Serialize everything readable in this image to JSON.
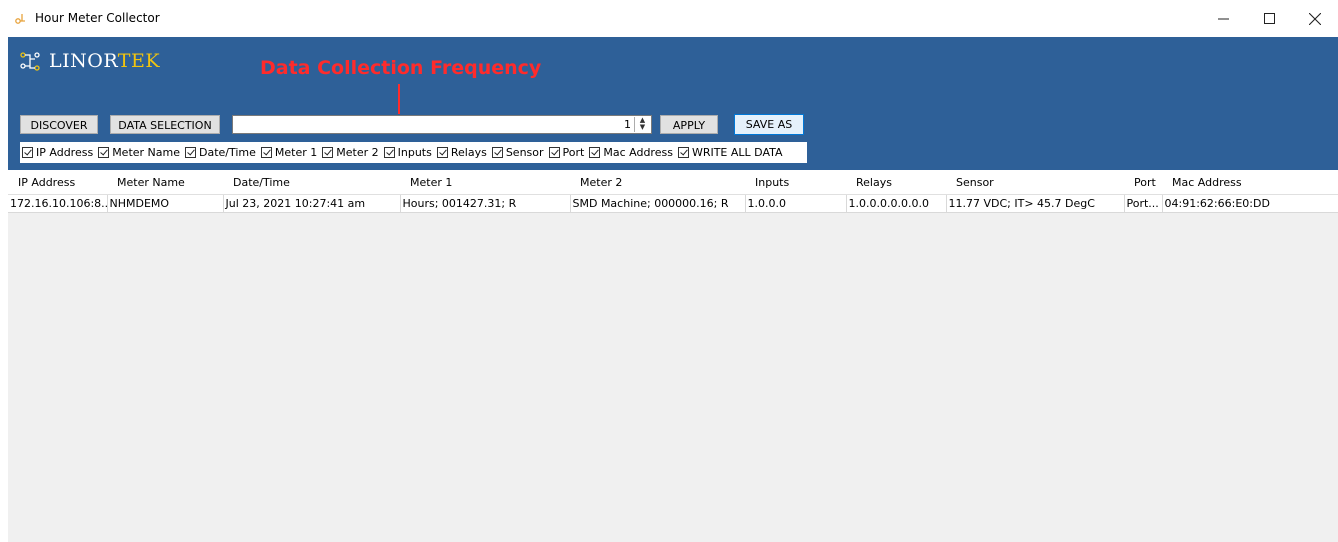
{
  "window": {
    "title": "Hour Meter Collector",
    "controls": {
      "minimize": "—",
      "maximize": "☐",
      "close": "✕"
    }
  },
  "header": {
    "logo": {
      "text_main": "LINOR",
      "text_accent": "TEK",
      "accent_color": "#f1c40f"
    },
    "annotation": {
      "text": "Data Collection Frequency",
      "color": "#ff2b2b"
    },
    "background_color": "#2e6098"
  },
  "toolbar": {
    "discover_label": "DISCOVER",
    "data_selection_label": "DATA SELECTION",
    "frequency_value": "1",
    "apply_label": "APPLY",
    "save_as_label": "SAVE AS"
  },
  "checkboxes": [
    {
      "label": "IP Address",
      "checked": true
    },
    {
      "label": "Meter Name",
      "checked": true
    },
    {
      "label": "Date/Time",
      "checked": true
    },
    {
      "label": "Meter 1",
      "checked": true
    },
    {
      "label": "Meter 2",
      "checked": true
    },
    {
      "label": "Inputs",
      "checked": true
    },
    {
      "label": "Relays",
      "checked": true
    },
    {
      "label": "Sensor",
      "checked": true
    },
    {
      "label": "Port",
      "checked": true
    },
    {
      "label": "Mac Address",
      "checked": true
    },
    {
      "label": "WRITE ALL DATA",
      "checked": true
    }
  ],
  "table": {
    "columns": [
      "IP Address",
      "Meter Name",
      "Date/Time",
      "Meter 1",
      "Meter 2",
      "Inputs",
      "Relays",
      "Sensor",
      "Port",
      "Mac Address"
    ],
    "rows": [
      [
        "172.16.10.106:8...",
        "NHMDEMO",
        "Jul 23, 2021  10:27:41 am",
        "Hours; 001427.31; R",
        "SMD Machine; 000000.16; R",
        "1.0.0.0",
        "1.0.0.0.0.0.0.0",
        "11.77 VDC; IT> 45.7 DegC",
        "Port...",
        "04:91:62:66:E0:DD"
      ]
    ]
  }
}
